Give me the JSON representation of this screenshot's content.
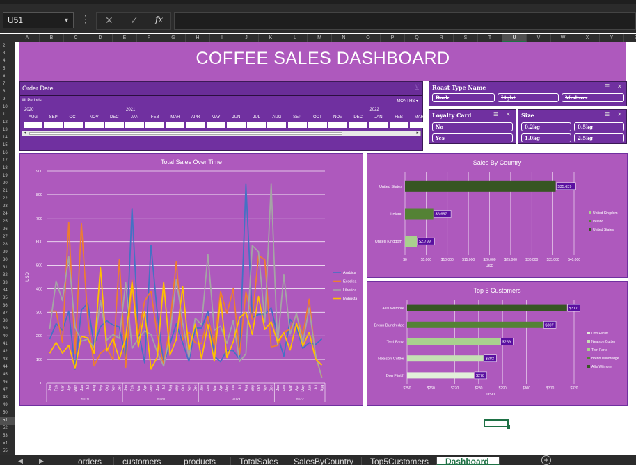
{
  "formula_bar": {
    "name_box": "U51",
    "more_label": "⋮",
    "cancel_label": "✕",
    "enter_label": "✓",
    "fx_label": "fx",
    "formula": ""
  },
  "columns": [
    "A",
    "B",
    "C",
    "D",
    "E",
    "F",
    "G",
    "H",
    "I",
    "J",
    "K",
    "L",
    "M",
    "N",
    "O",
    "P",
    "Q",
    "R",
    "S",
    "T",
    "U",
    "V",
    "W",
    "X",
    "Y",
    "Z"
  ],
  "selected_column": "U",
  "rows": [
    "2",
    "3",
    "4",
    "5",
    "6",
    "7",
    "8",
    "9",
    "10",
    "11",
    "12",
    "13",
    "14",
    "15",
    "16",
    "17",
    "18",
    "19",
    "20",
    "21",
    "22",
    "23",
    "24",
    "25",
    "26",
    "27",
    "28",
    "29",
    "30",
    "31",
    "32",
    "33",
    "34",
    "35",
    "36",
    "37",
    "38",
    "39",
    "40",
    "41",
    "42",
    "43",
    "44",
    "45",
    "46",
    "47",
    "48",
    "49",
    "50",
    "51",
    "52",
    "53",
    "54",
    "55"
  ],
  "selected_row": "51",
  "dashboard": {
    "title": "COFFEE SALES DASHBOARD"
  },
  "timeline": {
    "header": "Order Date",
    "periods_label": "All Periods",
    "unit_label": "MONTHS",
    "years": [
      "2020",
      "2021",
      "2022"
    ],
    "months": [
      "AUG",
      "SEP",
      "OCT",
      "NOV",
      "DEC",
      "JAN",
      "FEB",
      "MAR",
      "APR",
      "MAY",
      "JUN",
      "JUL",
      "AUG",
      "SEP",
      "OCT",
      "NOV",
      "DEC",
      "JAN",
      "FEB",
      "MAR"
    ]
  },
  "slicers": {
    "roast": {
      "title": "Roast Type Name",
      "items": [
        "Dark",
        "Light",
        "Medium"
      ]
    },
    "loyalty": {
      "title": "Loyalty Card",
      "items": [
        "No",
        "Yes"
      ]
    },
    "size": {
      "title": "Size",
      "items": [
        "0.2kg",
        "0.5kg",
        "1.0kg",
        "2.5kg"
      ]
    }
  },
  "tabs": [
    "orders",
    "customers",
    "products",
    "TotalSales",
    "SalesByCountry",
    "Top5Customers",
    "Dashboard"
  ],
  "active_tab": "Dashboard",
  "colors": {
    "panel": "#ae59bd",
    "slicer": "#7030a0",
    "arabica": "#4472c4",
    "excelsa": "#ed7d31",
    "liberica": "#a5a5a5",
    "robusta": "#ffc000",
    "bar_dark": "#375623",
    "bar_mid": "#548235",
    "bar_light": "#a9d18e",
    "bar_pale": "#c5e0b4",
    "bar_paler": "#e2efda",
    "label_bg": "#5a0fa0"
  },
  "chart_data": [
    {
      "type": "line",
      "title": "Total Sales Over Time",
      "ylabel": "USD",
      "ylim": [
        0,
        900
      ],
      "yticks": [
        0,
        100,
        200,
        300,
        400,
        500,
        600,
        700,
        800,
        900
      ],
      "x": [
        "Jan",
        "Feb",
        "Mar",
        "Apr",
        "May",
        "Jun",
        "Jul",
        "Aug",
        "Sep",
        "Oct",
        "Nov",
        "Dec",
        "Jan",
        "Feb",
        "Mar",
        "Apr",
        "May",
        "Jun",
        "Jul",
        "Aug",
        "Sep",
        "Oct",
        "Nov",
        "Dec",
        "Jan",
        "Feb",
        "Mar",
        "Apr",
        "May",
        "Jun",
        "Jul",
        "Aug",
        "Sep",
        "Oct",
        "Nov",
        "Dec",
        "Jan",
        "Feb",
        "Mar",
        "Apr",
        "May",
        "Jun",
        "Jul",
        "Aug"
      ],
      "year_groups": [
        {
          "label": "2019",
          "count": 12
        },
        {
          "label": "2020",
          "count": 12
        },
        {
          "label": "2021",
          "count": 12
        },
        {
          "label": "2022",
          "count": 8
        }
      ],
      "legend_position": "right",
      "series": [
        {
          "name": "Arabica",
          "color": "#4472c4",
          "values": [
            186,
            252,
            224,
            305,
            59,
            311,
            338,
            160,
            239,
            264,
            246,
            238,
            105,
            741,
            221,
            86,
            585,
            294,
            79,
            166,
            251,
            170,
            92,
            233,
            233,
            305,
            114,
            90,
            139,
            137,
            101,
            843,
            279,
            291,
            291,
            319,
            202,
            114,
            270,
            236,
            147,
            170,
            163,
            187
          ]
        },
        {
          "name": "Excelsa",
          "color": "#ed7d31",
          "values": [
            305,
            305,
            172,
            682,
            126,
            677,
            272,
            73,
            126,
            147,
            99,
            524,
            65,
            436,
            204,
            348,
            390,
            201,
            75,
            249,
            516,
            184,
            217,
            170,
            167,
            282,
            160,
            388,
            295,
            399,
            120,
            387,
            271,
            541,
            523,
            153,
            159,
            216,
            228,
            289,
            204,
            356,
            111,
            27
          ]
        },
        {
          "name": "Liberica",
          "color": "#a5a5a5",
          "values": [
            230,
            433,
            350,
            535,
            236,
            178,
            186,
            150,
            350,
            182,
            205,
            189,
            428,
            147,
            188,
            221,
            206,
            130,
            72,
            205,
            438,
            257,
            108,
            275,
            247,
            546,
            224,
            241,
            168,
            265,
            91,
            124,
            583,
            558,
            260,
            844,
            161,
            461,
            207,
            297,
            169,
            318,
            123,
            21
          ]
        },
        {
          "name": "Robusta",
          "color": "#ffc000",
          "values": [
            126,
            172,
            127,
            160,
            62,
            198,
            191,
            126,
            491,
            137,
            187,
            100,
            191,
            428,
            154,
            305,
            60,
            110,
            428,
            118,
            186,
            409,
            140,
            250,
            103,
            248,
            93,
            359,
            108,
            175,
            278,
            300,
            206,
            367,
            227,
            260,
            174,
            213,
            140,
            254,
            156,
            215,
            102,
            76
          ]
        }
      ]
    },
    {
      "type": "bar",
      "title": "Sales By Country",
      "orientation": "horizontal",
      "categories": [
        "United States",
        "Ireland",
        "United Kingdom"
      ],
      "values": [
        35639,
        6697,
        2799
      ],
      "value_labels": [
        "$35,639",
        "$6,697",
        "$2,799"
      ],
      "xlabel": "USD",
      "xlim": [
        0,
        40000
      ],
      "xticks": [
        "$0",
        "$5,000",
        "$10,000",
        "$15,000",
        "$20,000",
        "$25,000",
        "$30,000",
        "$35,000",
        "$40,000"
      ],
      "legend": [
        "United Kingdom",
        "Ireland",
        "United States"
      ]
    },
    {
      "type": "bar",
      "title": "Top 5 Customers",
      "orientation": "horizontal",
      "categories": [
        "Allis Wilmore",
        "Brenn Dundredge",
        "Terri Farra",
        "Nealson Cuttler",
        "Don Flintiff"
      ],
      "values": [
        317,
        307,
        289,
        282,
        278
      ],
      "value_labels": [
        "$317",
        "$307",
        "$289",
        "$282",
        "$278"
      ],
      "xlabel": "USD",
      "xlim": [
        250,
        320
      ],
      "xticks": [
        "$250",
        "$260",
        "$270",
        "$280",
        "$290",
        "$300",
        "$310",
        "$320"
      ],
      "legend": [
        "Don Flintiff",
        "Nealson Cuttler",
        "Terri Farra",
        "Brenn Dundredge",
        "Allis Wilmore"
      ]
    }
  ]
}
